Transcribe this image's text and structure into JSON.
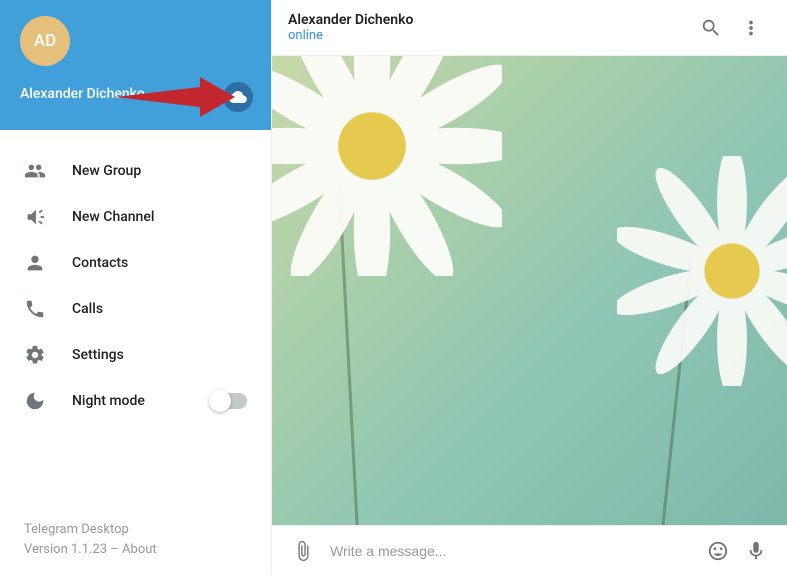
{
  "profile": {
    "initials": "AD",
    "name": "Alexander Dichenko"
  },
  "menu": {
    "new_group": "New Group",
    "new_channel": "New Channel",
    "contacts": "Contacts",
    "calls": "Calls",
    "settings": "Settings",
    "night_mode": "Night mode"
  },
  "footer": {
    "app_name": "Telegram Desktop",
    "version_prefix": "Version 1.1.23 – ",
    "about_label": "About"
  },
  "chat": {
    "name": "Alexander Dichenko",
    "status": "online"
  },
  "composer": {
    "placeholder": "Write a message..."
  },
  "colors": {
    "brand_blue": "#419fd9",
    "link_blue": "#3390ec",
    "avatar_bg": "#e5c07b",
    "cloud_bg": "#2f6ea5",
    "annotation_arrow": "#c1272d"
  }
}
